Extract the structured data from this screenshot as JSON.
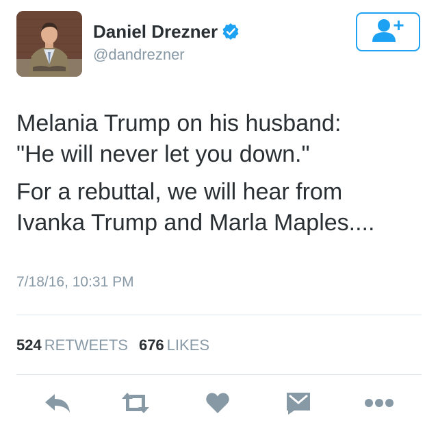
{
  "user": {
    "display_name": "Daniel Drezner",
    "handle": "@dandrezner",
    "verified": true
  },
  "follow_button": {
    "icon": "add-user-icon"
  },
  "tweet": {
    "paragraphs": [
      "Melania Trump on his husband: \"He will never let you down.\"",
      "For a rebuttal, we will hear from Ivanka Trump and Marla Maples...."
    ],
    "lines": [
      "Melania Trump on his husband:",
      "\"He will never let you down.\"",
      "For a rebuttal, we will hear from",
      "Ivanka Trump and Marla Maples...."
    ],
    "timestamp": "7/18/16, 10:31 PM"
  },
  "stats": {
    "retweets_count": "524",
    "retweets_label": "RETWEETS",
    "likes_count": "676",
    "likes_label": "LIKES"
  },
  "actions": [
    {
      "name": "reply",
      "icon": "reply-icon"
    },
    {
      "name": "retweet",
      "icon": "retweet-icon"
    },
    {
      "name": "like",
      "icon": "heart-icon"
    },
    {
      "name": "message",
      "icon": "envelope-icon"
    },
    {
      "name": "more",
      "icon": "more-dots-icon"
    }
  ],
  "colors": {
    "accent": "#1da1f2",
    "icon_gray": "#8899a6",
    "text": "#292f33",
    "divider": "#e1e8ed"
  }
}
